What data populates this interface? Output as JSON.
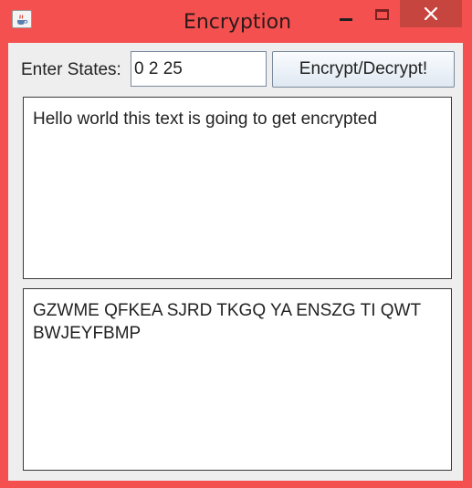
{
  "window": {
    "title": "Encryption",
    "app_icon": "java-coffee-cup-icon",
    "controls": {
      "minimize_icon": "minimize-icon",
      "maximize_icon": "maximize-icon",
      "close_icon": "close-icon"
    },
    "colors": {
      "frame": "#f55050",
      "close_button": "#c7453f",
      "client": "#eeeeee"
    }
  },
  "form": {
    "states_label": "Enter States:",
    "states_value": "0 2 25",
    "encrypt_button_label": "Encrypt/Decrypt!"
  },
  "plaintext": {
    "value": "Hello world this text is going to get encrypted"
  },
  "ciphertext": {
    "value": "GZWME QFKEA SJRD TKGQ YA ENSZG TI QWT BWJEYFBMP"
  }
}
